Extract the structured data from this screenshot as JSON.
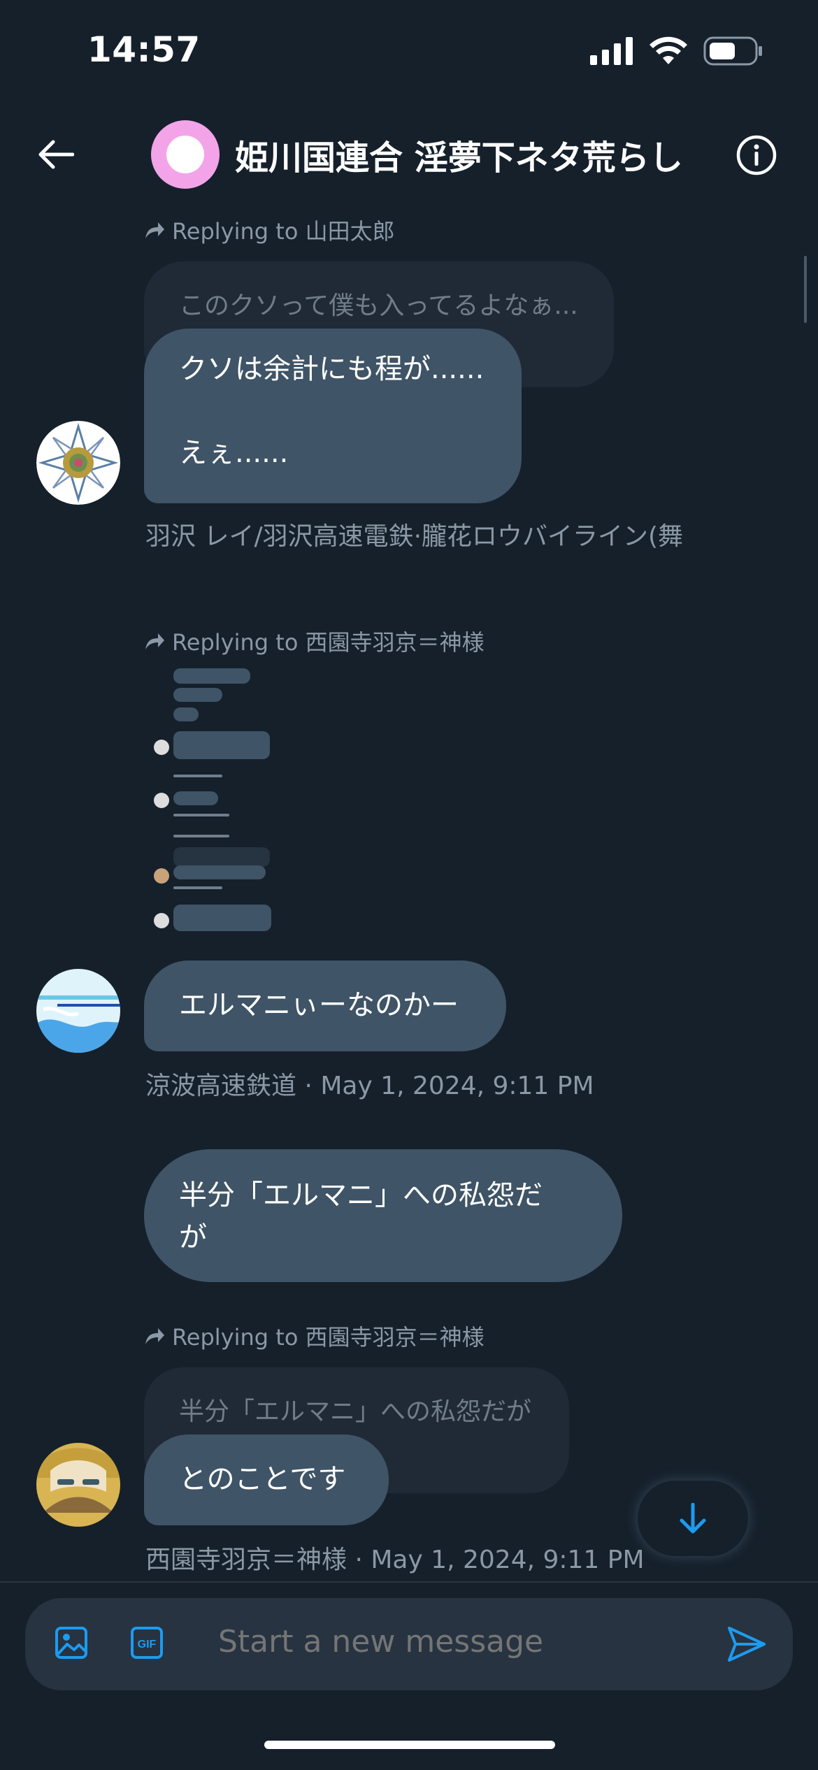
{
  "status_bar": {
    "time": "14:57"
  },
  "header": {
    "title": "姫川国連合 淫夢下ネタ荒らし"
  },
  "messages": [
    {
      "replying_to": "Replying to 山田太郎",
      "quoted_text": "このクソって僕も入ってるよなぁ...",
      "text_line1": "クソは余計にも程が......",
      "text_line2": "えぇ......",
      "meta": "羽沢 レイ/羽沢高速電鉄·朧花ロウバイライン(舞"
    },
    {
      "replying_to": "Replying to 西園寺羽京＝神様",
      "text": "エルマニぃーなのかー",
      "meta": "涼波高速鉄道 · May 1, 2024, 9:11 PM"
    },
    {
      "text_line1": "半分「エルマニ」への私怨だ",
      "text_line2": "が"
    },
    {
      "replying_to": "Replying to 西園寺羽京＝神様",
      "quoted_text": "半分「エルマニ」への私怨だが",
      "text": "とのことです",
      "meta": "西園寺羽京＝神様 · May 1, 2024, 9:11 PM"
    }
  ],
  "composer": {
    "placeholder": "Start a new message"
  },
  "colors": {
    "accent": "#1d9bf0",
    "bubble": "#3f5466",
    "background": "#15202b"
  }
}
